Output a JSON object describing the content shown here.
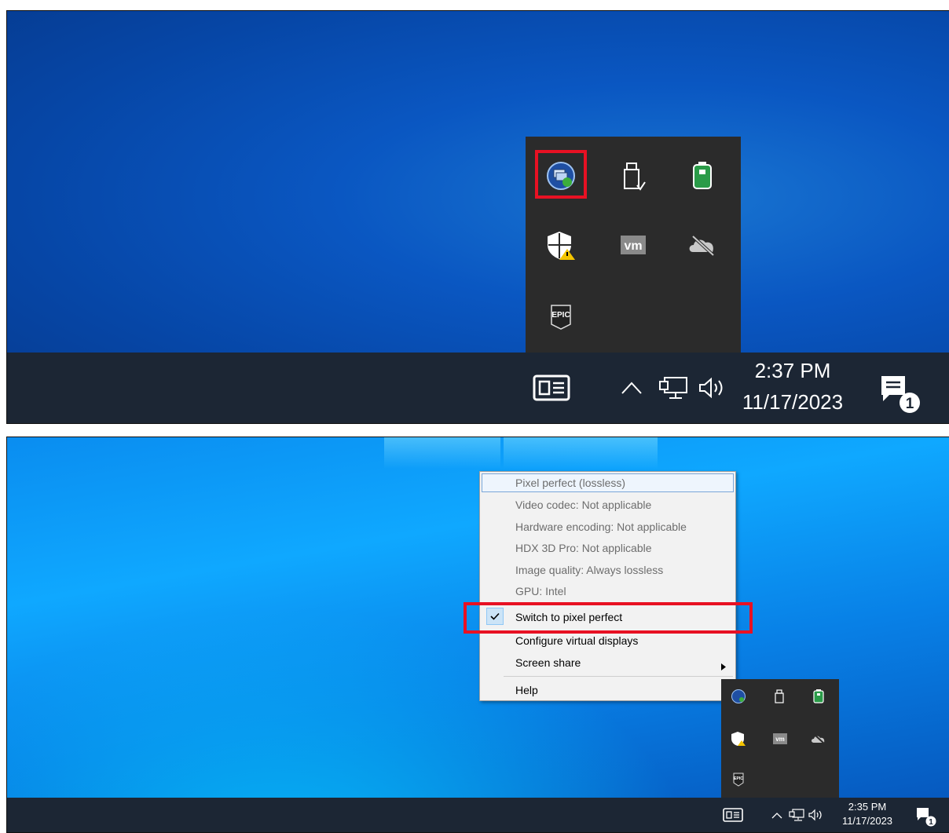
{
  "top_panel": {
    "taskbar": {
      "time": "2:37 PM",
      "date": "11/17/2023",
      "notification_count": "1"
    },
    "tray_icons": [
      {
        "name": "citrix-workspace-icon",
        "highlighted": true
      },
      {
        "name": "usb-eject-icon"
      },
      {
        "name": "battery-icon"
      },
      {
        "name": "windows-security-warning-icon"
      },
      {
        "name": "vmware-icon"
      },
      {
        "name": "onedrive-offline-icon"
      },
      {
        "name": "epic-games-icon",
        "text": "EPIC"
      }
    ]
  },
  "bottom_panel": {
    "taskbar": {
      "time": "2:35 PM",
      "date": "11/17/2023",
      "notification_count": "1"
    },
    "context_menu": {
      "info_items": [
        "Pixel perfect (lossless)",
        "Video codec: Not applicable",
        "Hardware encoding: Not applicable",
        "HDX 3D Pro: Not applicable",
        "Image quality: Always lossless",
        "GPU: Intel"
      ],
      "switch_item": {
        "label": "Switch to pixel perfect",
        "checked": true
      },
      "configure_item": "Configure virtual displays",
      "screen_share_item": "Screen share",
      "help_item": "Help"
    }
  },
  "colors": {
    "highlight": "#e81123",
    "taskbar": "#1c2634",
    "flyout": "#2b2b2b"
  }
}
